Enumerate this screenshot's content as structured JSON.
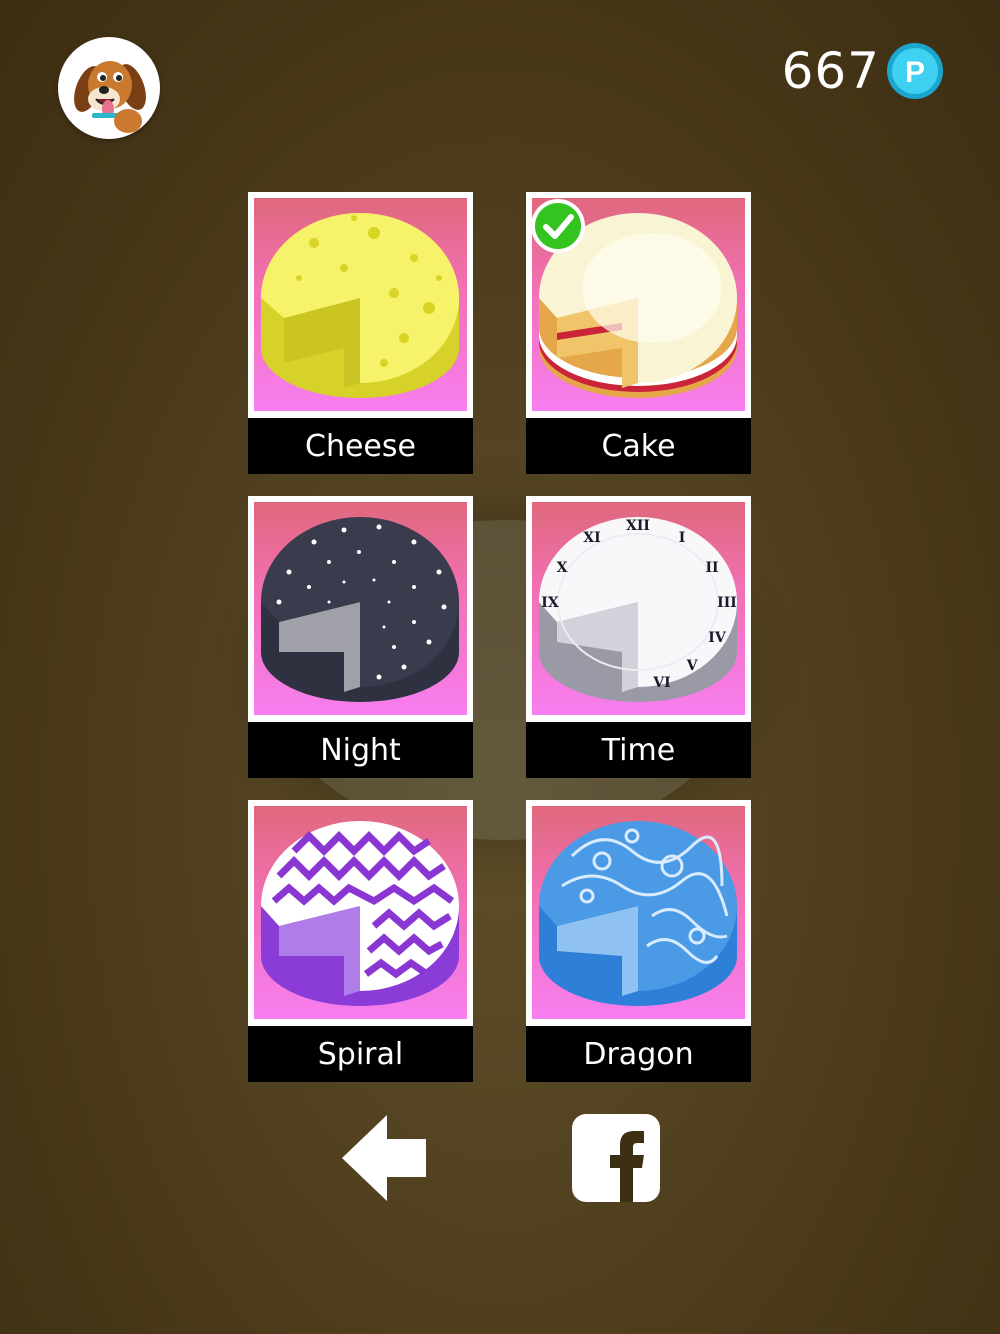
{
  "header": {
    "coin_count": "667",
    "coin_symbol": "P",
    "avatar_icon": "dog-avatar-icon"
  },
  "skins": [
    {
      "label": "Cheese",
      "selected": false
    },
    {
      "label": "Cake",
      "selected": true
    },
    {
      "label": "Night",
      "selected": false
    },
    {
      "label": "Time",
      "selected": false
    },
    {
      "label": "Spiral",
      "selected": false
    },
    {
      "label": "Dragon",
      "selected": false
    }
  ],
  "footer": {
    "back_icon": "back-arrow-icon",
    "share_icon": "facebook-icon"
  },
  "colors": {
    "card_gradient_top": "#e0687c",
    "card_gradient_bottom": "#f77ef0",
    "coin": "#27c0e6",
    "check": "#33c41f"
  }
}
